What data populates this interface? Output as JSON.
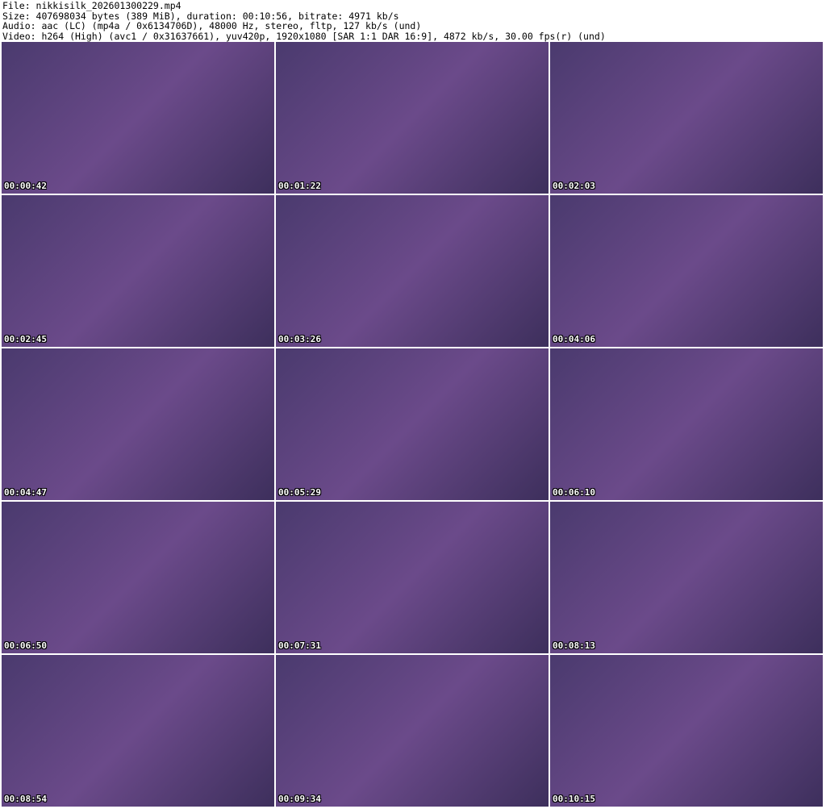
{
  "header": {
    "file": "File: nikkisilk_202601300229.mp4",
    "size": "Size: 407698034 bytes (389 MiB), duration: 00:10:56, bitrate: 4971 kb/s",
    "audio": "Audio: aac (LC) (mp4a / 0x6134706D), 48000 Hz, stereo, fltp, 127 kb/s (und)",
    "video": "Video: h264 (High) (avc1 / 0x31637661), yuv420p, 1920x1080 [SAR 1:1 DAR 16:9], 4872 kb/s, 30.00 fps(r) (und)"
  },
  "thumbnails": [
    {
      "time": "00:00:42"
    },
    {
      "time": "00:01:22"
    },
    {
      "time": "00:02:03"
    },
    {
      "time": "00:02:45"
    },
    {
      "time": "00:03:26"
    },
    {
      "time": "00:04:06"
    },
    {
      "time": "00:04:47"
    },
    {
      "time": "00:05:29"
    },
    {
      "time": "00:06:10"
    },
    {
      "time": "00:06:50"
    },
    {
      "time": "00:07:31"
    },
    {
      "time": "00:08:13"
    },
    {
      "time": "00:08:54"
    },
    {
      "time": "00:09:34"
    },
    {
      "time": "00:10:15"
    }
  ]
}
